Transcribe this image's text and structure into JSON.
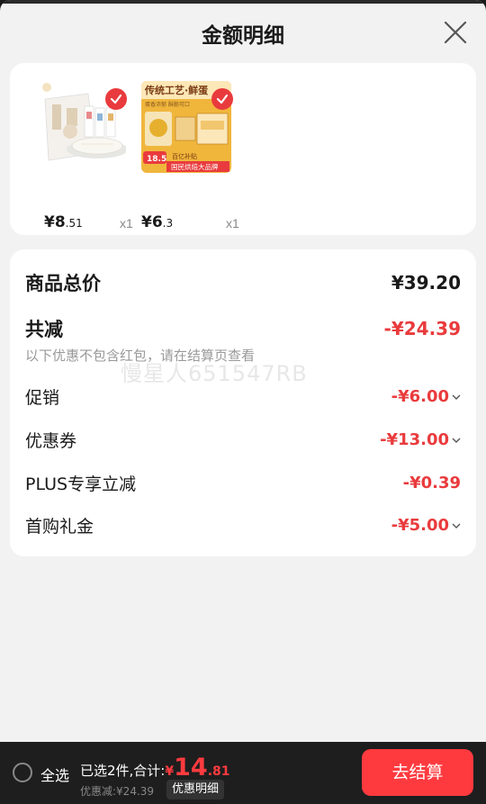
{
  "header": {
    "title": "金额明细",
    "close_icon": "close-icon"
  },
  "products": [
    {
      "price_int": "¥8",
      "price_dec": ".51",
      "qty": "x1",
      "selected": true
    },
    {
      "price_int": "¥6",
      "price_dec": ".3",
      "qty": "x1",
      "selected": true,
      "img_text": {
        "headline": "传统工艺·鲜蛋",
        "sub": "蛋香浓郁 酥脆可口",
        "badge_num": "18.5",
        "badge_text": "百亿补贴",
        "banner": "国民烘焙大品牌"
      }
    }
  ],
  "summary": {
    "total_label": "商品总价",
    "total_value": "¥39.20",
    "reduce_label": "共减",
    "reduce_value": "-¥24.39",
    "note": "以下优惠不包含红包，请在结算页查看",
    "watermark": "慢星人651547RB",
    "items": [
      {
        "label": "促销",
        "value": "-¥6.00",
        "expandable": true
      },
      {
        "label": "优惠券",
        "value": "-¥13.00",
        "expandable": true
      },
      {
        "label": "PLUS专享立减",
        "value": "-¥0.39",
        "expandable": false
      },
      {
        "label": "首购礼金",
        "value": "-¥5.00",
        "expandable": true
      }
    ]
  },
  "bottom_bar": {
    "select_all": "全选",
    "selected_text": "已选2件,合计:",
    "yen": "¥",
    "total_int": "14",
    "total_dec": ".81",
    "discount_text": "优惠减:¥24.39",
    "detail_tag": "优惠明细",
    "checkout": "去结算"
  },
  "colors": {
    "accent": "#e93b3d",
    "checkout": "#ff3a3f",
    "bar": "#1e1e1e",
    "sheet": "#f2f2f2"
  }
}
